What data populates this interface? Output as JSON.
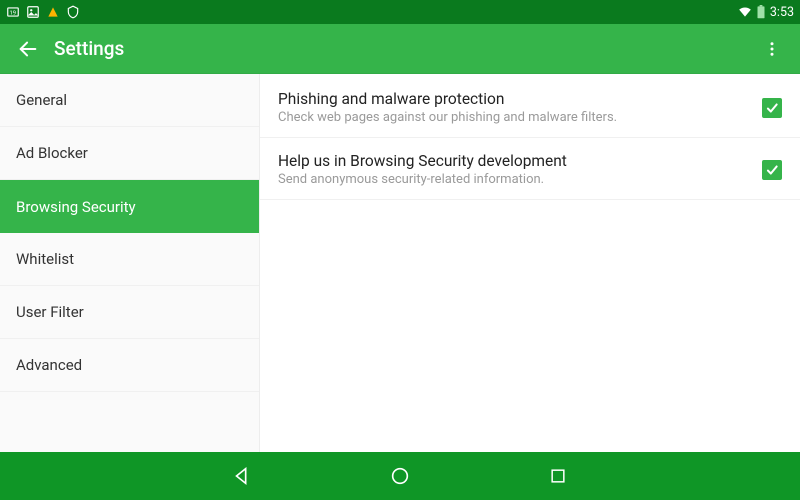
{
  "statusbar": {
    "time": "3:53"
  },
  "appbar": {
    "title": "Settings"
  },
  "sidebar": {
    "items": [
      {
        "label": "General",
        "selected": false
      },
      {
        "label": "Ad Blocker",
        "selected": false
      },
      {
        "label": "Browsing Security",
        "selected": true
      },
      {
        "label": "Whitelist",
        "selected": false
      },
      {
        "label": "User Filter",
        "selected": false
      },
      {
        "label": "Advanced",
        "selected": false
      }
    ]
  },
  "content": {
    "settings": [
      {
        "title": "Phishing and malware protection",
        "subtitle": "Check web pages against our phishing and malware filters.",
        "checked": true
      },
      {
        "title": "Help us in Browsing Security development",
        "subtitle": "Send anonymous security-related information.",
        "checked": true
      }
    ]
  }
}
